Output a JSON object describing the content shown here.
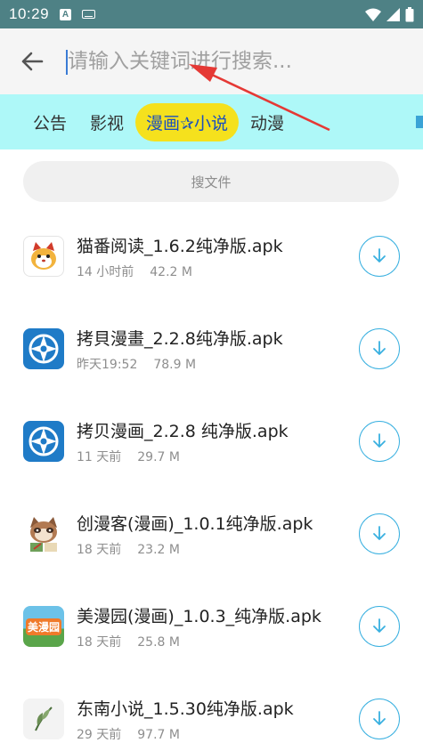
{
  "status_bar": {
    "time": "10:29",
    "notif_letter": "A"
  },
  "search": {
    "placeholder": "请输入关键词进行搜索..."
  },
  "tabs": [
    {
      "label": "公告",
      "active": false
    },
    {
      "label": "影视",
      "active": false
    },
    {
      "label": "漫画✰小说",
      "active": true
    },
    {
      "label": "动漫",
      "active": false
    }
  ],
  "search_file_label": "搜文件",
  "files": [
    {
      "name": "猫番阅读_1.6.2纯净版.apk",
      "time": "14 小时前",
      "size": "42.2 M",
      "icon": "cat-app-icon"
    },
    {
      "name": "拷貝漫畫_2.2.8纯净版.apk",
      "time": "昨天19:52",
      "size": "78.9 M",
      "icon": "copymanga-icon"
    },
    {
      "name": "拷贝漫画_2.2.8 纯净版.apk",
      "time": "11 天前",
      "size": "29.7 M",
      "icon": "copymanga-icon"
    },
    {
      "name": "创漫客(漫画)_1.0.1纯净版.apk",
      "time": "18 天前",
      "size": "23.2 M",
      "icon": "raccoon-app-icon"
    },
    {
      "name": "美漫园(漫画)_1.0.3_纯净版.apk",
      "time": "18 天前",
      "size": "25.8 M",
      "icon": "meimanyuan-icon"
    },
    {
      "name": "东南小说_1.5.30纯净版.apk",
      "time": "29 天前",
      "size": "97.7 M",
      "icon": "leaf-app-icon"
    }
  ],
  "meimanyuan_icon_text": "美漫园",
  "colors": {
    "status_bar": "#4e8185",
    "tabs_bg": "#aef8f8",
    "active_tab": "#f5e11d",
    "accent": "#39b0e0",
    "annotation": "#e53935"
  }
}
